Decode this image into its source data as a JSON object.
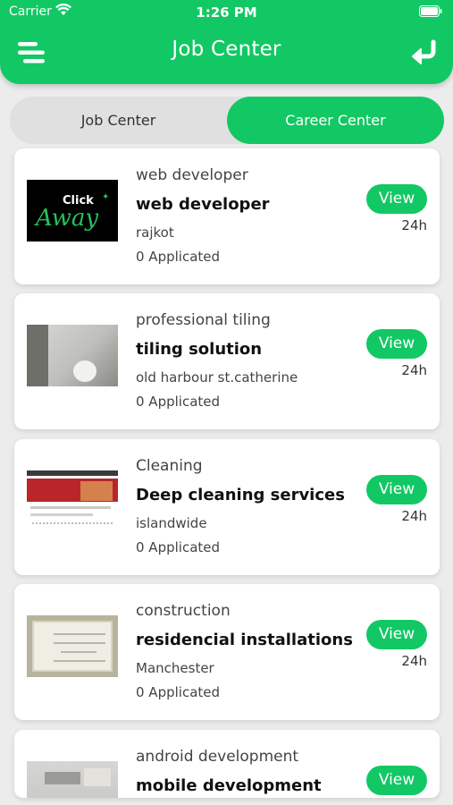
{
  "status_bar": {
    "carrier": "Carrier",
    "time": "1:26 PM"
  },
  "header": {
    "title": "Job Center",
    "menu_icon": "menu-icon",
    "back_icon": "return-arrow-icon"
  },
  "tabs": [
    {
      "label": "Job Center",
      "selected": false
    },
    {
      "label": "Career Center",
      "selected": true
    }
  ],
  "colors": {
    "accent": "#12c864",
    "background": "#ececec"
  },
  "jobs": [
    {
      "category": "web developer",
      "title": "web developer",
      "location": "rajkot",
      "applied": "0 Applicated",
      "view_label": "View",
      "age": "24h",
      "thumb": "click-away-logo"
    },
    {
      "category": "professional tiling",
      "title": "tiling solution",
      "location": "old harbour st.catherine",
      "applied": "0 Applicated",
      "view_label": "View",
      "age": "24h",
      "thumb": "bathroom-photo"
    },
    {
      "category": "Cleaning",
      "title": "Deep cleaning services",
      "location": "islandwide",
      "applied": "0 Applicated",
      "view_label": "View",
      "age": "24h",
      "thumb": "website-screenshot"
    },
    {
      "category": "construction",
      "title": "residencial installations",
      "location": "Manchester",
      "applied": "0 Applicated",
      "view_label": "View",
      "age": "24h",
      "thumb": "certificate-photo"
    },
    {
      "category": "android development",
      "title": "mobile development",
      "location": "",
      "applied": "",
      "view_label": "View",
      "age": "",
      "thumb": "desk-photo"
    }
  ],
  "thumb_text": {
    "click": "Click",
    "away": "Away"
  }
}
